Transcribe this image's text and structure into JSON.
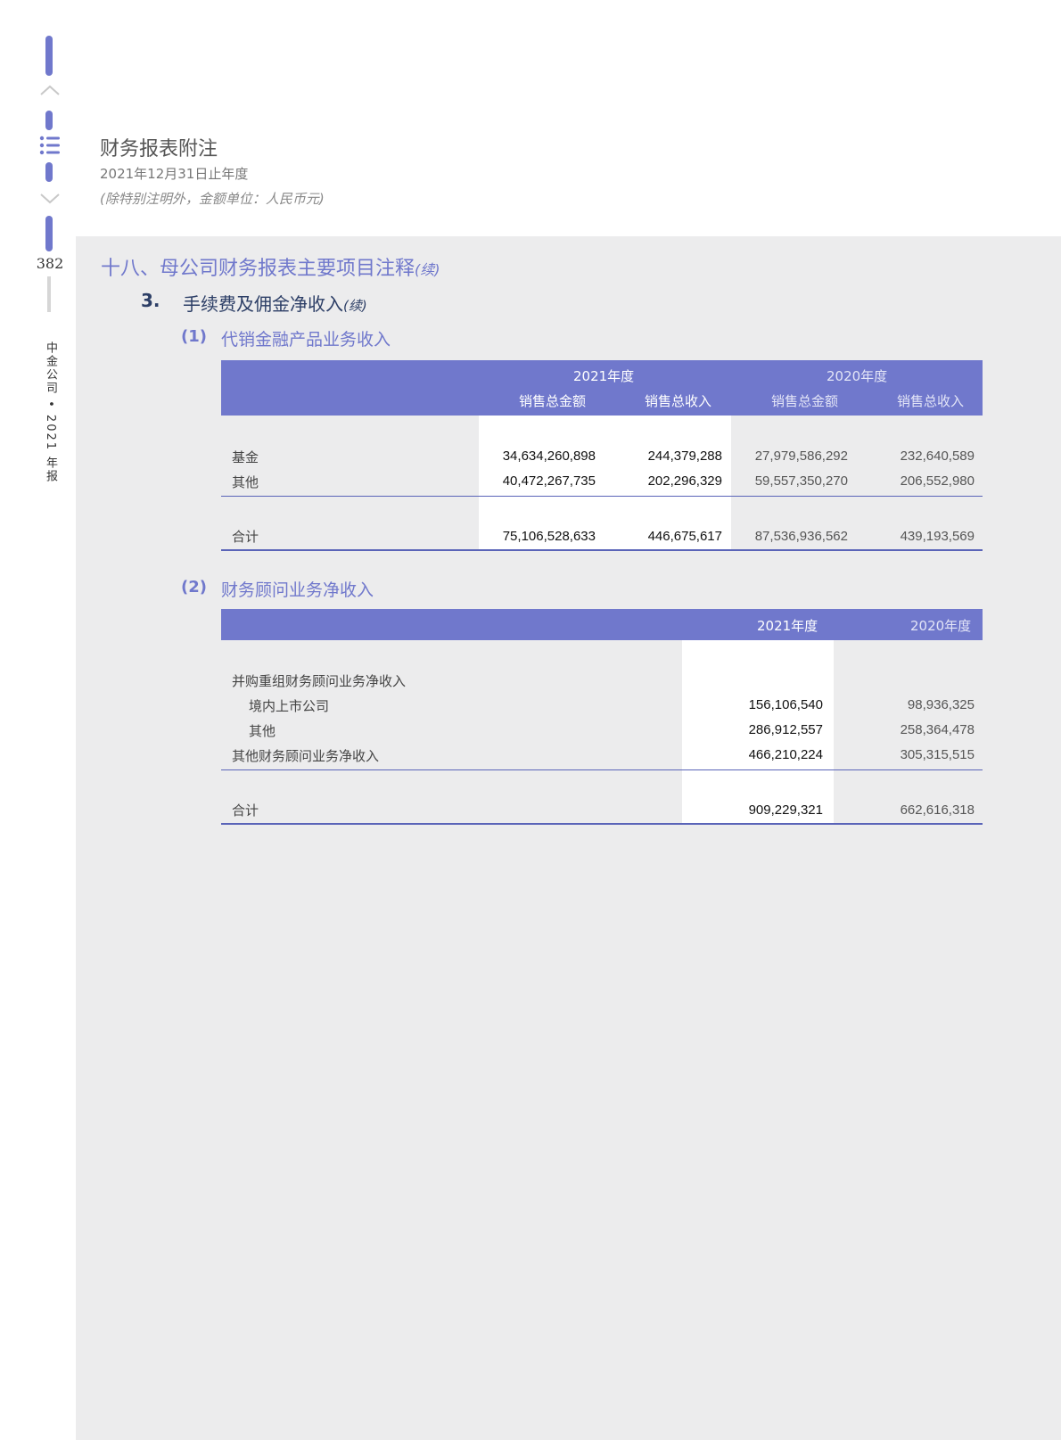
{
  "sidebar": {
    "page_number": "382",
    "vertical_text": "中金公司 • 2021 年报"
  },
  "header": {
    "title": "财务报表附注",
    "date": "2021年12月31日止年度",
    "unit_note": "(除特别注明外，金额单位：人民币元)"
  },
  "section": {
    "title": "十八、母公司财务报表主要项目注释",
    "cont": "(续)",
    "item_num": "3.",
    "item_label": "手续费及佣金净收入",
    "item_cont": "(续)"
  },
  "table1": {
    "num": "(1)",
    "label": "代销金融产品业务收入",
    "year_2021": "2021年度",
    "year_2020": "2020年度",
    "col_amount": "销售总金额",
    "col_income": "销售总收入",
    "rows": [
      {
        "label": "基金",
        "a21": "34,634,260,898",
        "i21": "244,379,288",
        "a20": "27,979,586,292",
        "i20": "232,640,589"
      },
      {
        "label": "其他",
        "a21": "40,472,267,735",
        "i21": "202,296,329",
        "a20": "59,557,350,270",
        "i20": "206,552,980"
      }
    ],
    "total": {
      "label": "合计",
      "a21": "75,106,528,633",
      "i21": "446,675,617",
      "a20": "87,536,936,562",
      "i20": "439,193,569"
    }
  },
  "table2": {
    "num": "(2)",
    "label": "财务顾问业务净收入",
    "year_2021": "2021年度",
    "year_2020": "2020年度",
    "rows": [
      {
        "label": "并购重组财务顾问业务净收入",
        "v21": "",
        "v20": ""
      },
      {
        "label": "境内上市公司",
        "v21": "156,106,540",
        "v20": "98,936,325"
      },
      {
        "label": "其他",
        "v21": "286,912,557",
        "v20": "258,364,478"
      },
      {
        "label": "其他财务顾问业务净收入",
        "v21": "466,210,224",
        "v20": "305,315,515"
      }
    ],
    "total": {
      "label": "合计",
      "v21": "909,229,321",
      "v20": "662,616,318"
    }
  }
}
